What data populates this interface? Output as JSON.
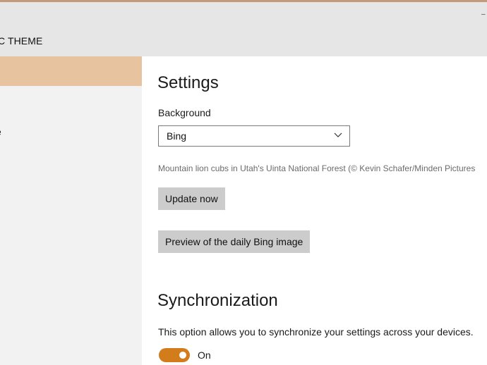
{
  "app": {
    "title": "C THEME",
    "window_control_glyph": "–"
  },
  "sidebar": {
    "items": [
      {
        "label": "",
        "selected": true
      },
      {
        "label": "e",
        "selected": false
      }
    ]
  },
  "settings": {
    "title": "Settings",
    "background_label": "Background",
    "background_value": "Bing",
    "background_caption": "Mountain lion cubs in Utah's Uinta National Forest (© Kevin Schafer/Minden Pictures",
    "update_button": "Update now",
    "preview_button": "Preview of the daily Bing image"
  },
  "synchronization": {
    "title": "Synchronization",
    "description": "This option allows you to synchronize your settings across your devices.",
    "toggle_state": "On",
    "toggle_on": true
  },
  "colors": {
    "accent": "#d27c1c",
    "nav_selected": "#e8c39f",
    "titlebar": "#e6e6e6",
    "sidebar": "#f2f2f2",
    "button": "#cccccc"
  },
  "icons": {
    "dropdown": "chevron-down-icon"
  }
}
